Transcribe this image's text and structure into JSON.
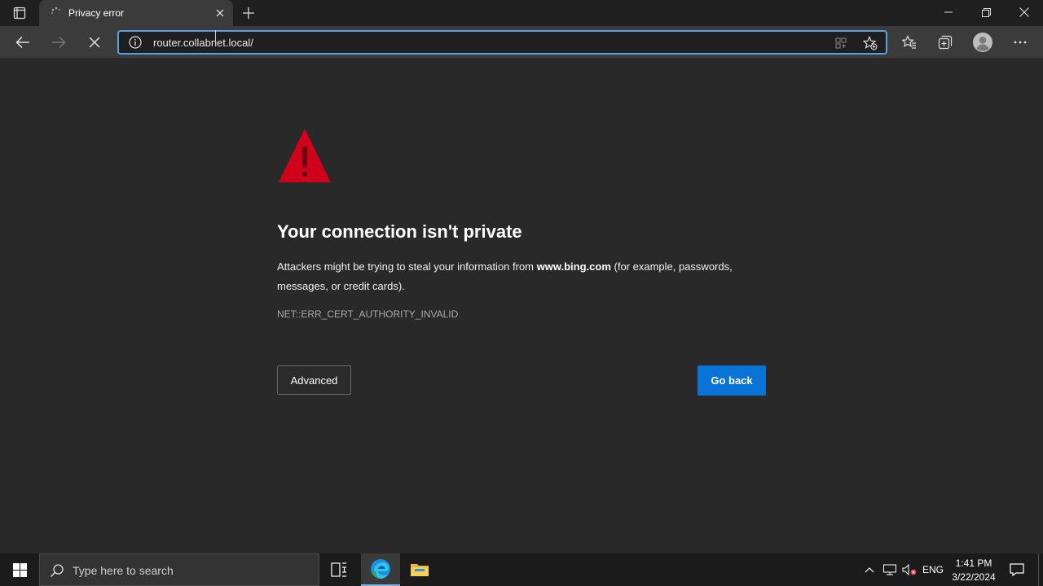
{
  "browser": {
    "tab": {
      "title": "Privacy error"
    },
    "address_bar": {
      "url": "router.collabnet.local/"
    }
  },
  "page": {
    "heading": "Your connection isn't private",
    "description_before": "Attackers might be trying to steal your information from ",
    "description_domain": "www.bing.com",
    "description_after": " (for example, passwords, messages, or credit cards).",
    "error_code": "NET::ERR_CERT_AUTHORITY_INVALID",
    "advanced_label": "Advanced",
    "go_back_label": "Go back"
  },
  "taskbar": {
    "search_placeholder": "Type here to search",
    "language": "ENG",
    "time": "1:41 PM",
    "date": "3/22/2024"
  },
  "colors": {
    "accent": "#0a74d6",
    "warning": "#d0021b",
    "page_bg": "#292929"
  }
}
